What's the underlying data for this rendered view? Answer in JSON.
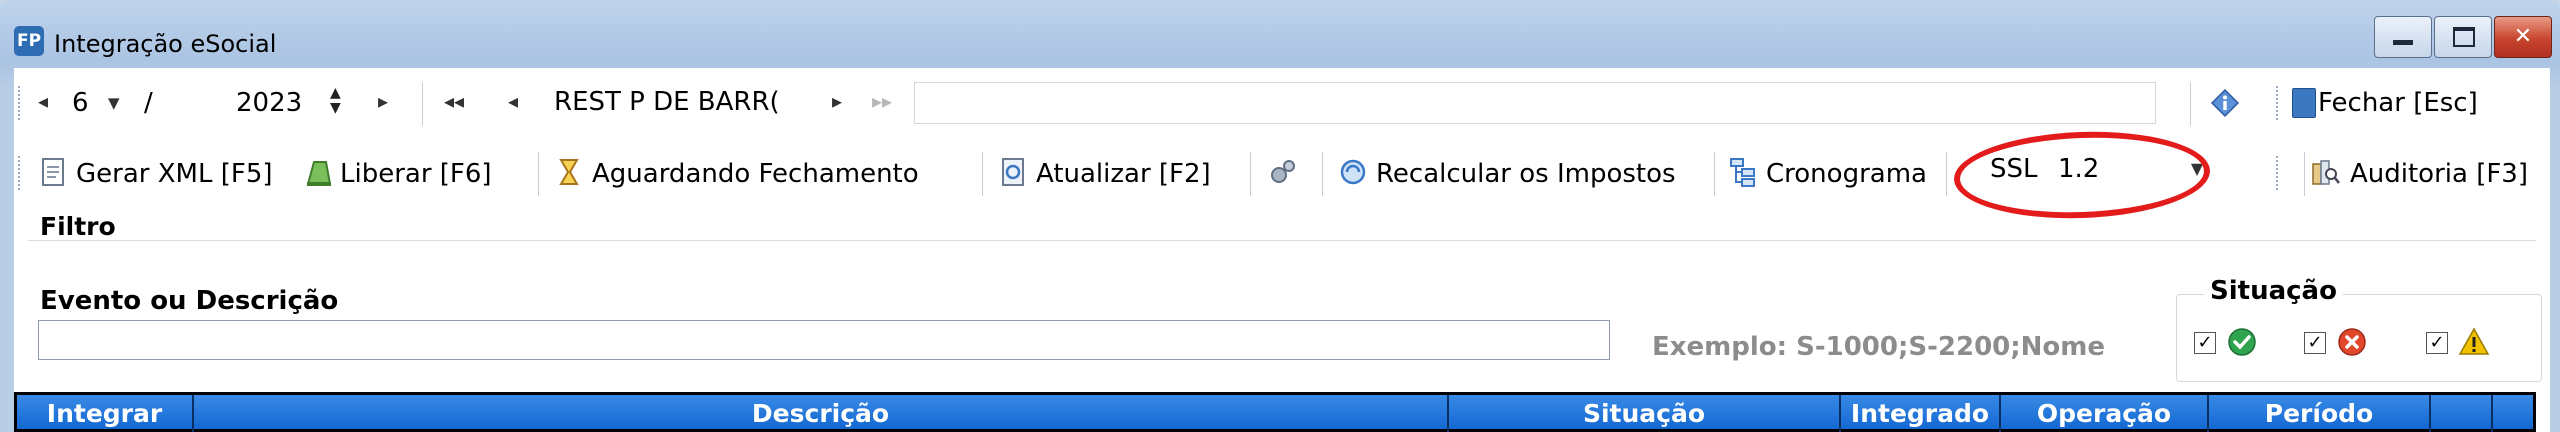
{
  "window": {
    "title": "Integração eSocial",
    "app_icon_text": "FP"
  },
  "nav": {
    "month": "6",
    "separator": "/",
    "year": "2023",
    "company_code": "REST P DE BARR(",
    "fechar_label": "Fechar [Esc]"
  },
  "toolbar": {
    "gerar_xml": "Gerar XML [F5]",
    "liberar": "Liberar [F6]",
    "aguardando": "Aguardando Fechamento",
    "atualizar": "Atualizar [F2]",
    "recalcular": "Recalcular os Impostos",
    "cronograma": "Cronograma",
    "ssl_label": "SSL",
    "ssl_value": "1.2",
    "auditoria": "Auditoria [F3]"
  },
  "filter": {
    "group_label": "Filtro",
    "evento_label": "Evento ou Descrição",
    "search_value": "",
    "example_text": "Exemplo: S-1000;S-2200;Nome",
    "situacao_label": "Situação",
    "situacao_checks": [
      {
        "checked": true,
        "icon": "check-circle-icon",
        "color": "#2ea44f"
      },
      {
        "checked": true,
        "icon": "error-circle-icon",
        "color": "#e0472b"
      },
      {
        "checked": true,
        "icon": "warning-triangle-icon",
        "color": "#f2c200"
      }
    ]
  },
  "grid": {
    "columns": [
      "Integrar",
      "Descrição",
      "Situação",
      "Integrado",
      "Operação",
      "Período",
      "",
      ""
    ]
  },
  "colors": {
    "grid_header": "#1e74dc",
    "highlight_ring": "#e31b1b"
  }
}
